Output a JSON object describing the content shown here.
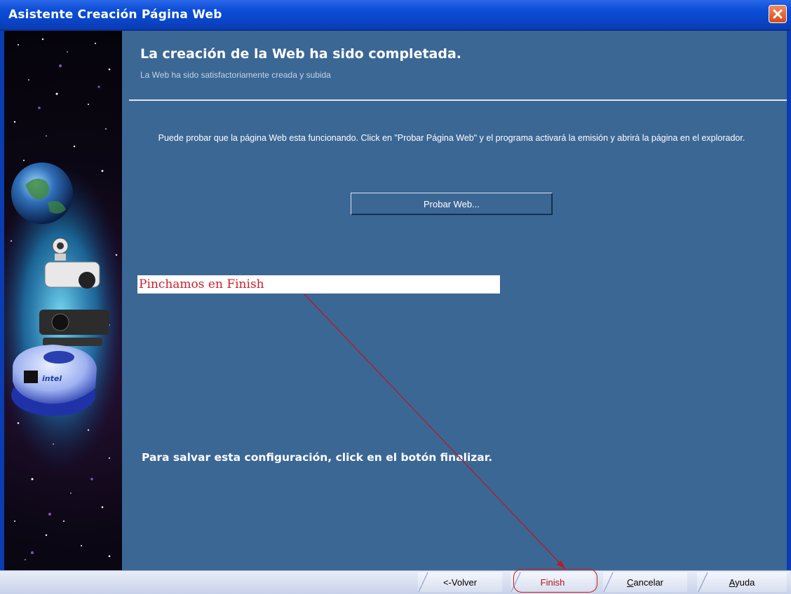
{
  "window": {
    "title": "Asistente Creación Página Web"
  },
  "main": {
    "heading": "La creación de la Web ha sido completada.",
    "subheading": "La Web ha sido satisfactoriamente creada y subida",
    "info_text": "Puede probar que la página Web esta funcionando. Click en \"Probar Página Web\" y el programa activará la emisión y abrirá la página en el explorador.",
    "probar_button": "Probar Web...",
    "save_text": "Para salvar esta configuración, click en el botón finalizar."
  },
  "annotation": {
    "text": "Pinchamos en Finish",
    "color": "#cc1f2b"
  },
  "buttons": {
    "back": "<-Volver",
    "finish": "Finish",
    "cancel_underline": "C",
    "cancel_rest": "ancelar",
    "help_underline": "A",
    "help_rest": "yuda"
  },
  "colors": {
    "content_bg": "#3b6795",
    "titlebar": "#0b4ed6",
    "close": "#d44a1a"
  },
  "side_panel_icons": [
    "globe-icon",
    "webcam-icon",
    "camera-icon",
    "intel-camera-icon"
  ]
}
